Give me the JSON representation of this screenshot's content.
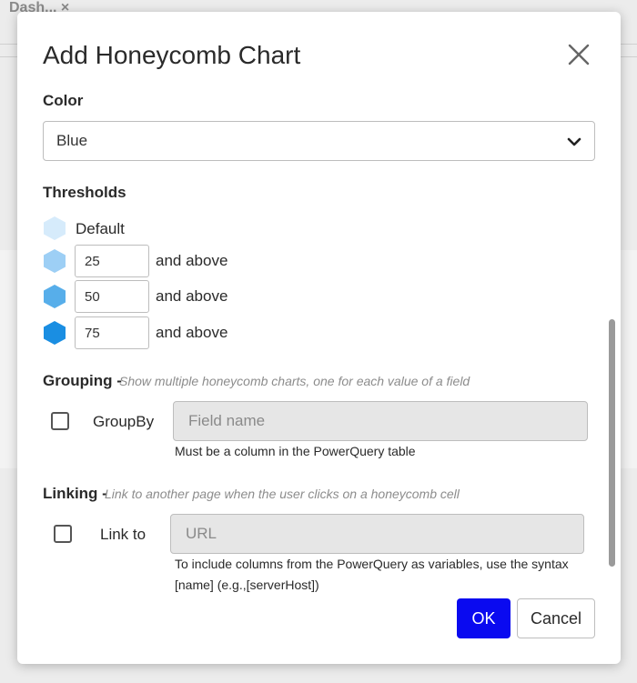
{
  "background": {
    "tab_label": "Dash... ×"
  },
  "dialog": {
    "title": "Add Honeycomb Chart",
    "close_icon": "close-icon",
    "color": {
      "label": "Color",
      "selected": "Blue"
    },
    "thresholds": {
      "label": "Thresholds",
      "default_label": "Default",
      "suffix": "and above",
      "items": [
        {
          "value": "25",
          "color": "#9dcff5"
        },
        {
          "value": "50",
          "color": "#57aeea"
        },
        {
          "value": "75",
          "color": "#1a8ee2"
        }
      ],
      "default_color": "#d6ebfb"
    },
    "grouping": {
      "label": "Grouping -",
      "hint": "Show multiple honeycomb charts, one for each value of a field",
      "checkbox_label": "GroupBy",
      "placeholder": "Field name",
      "help": "Must be a column in the PowerQuery table"
    },
    "linking": {
      "label": "Linking -",
      "hint": "Link to another page when the user clicks on a honeycomb cell",
      "checkbox_label": "Link to",
      "placeholder": "URL",
      "help_line1": "To include columns from the PowerQuery as variables, use the syntax",
      "help_line2": "[name] (e.g.,[serverHost])"
    },
    "buttons": {
      "ok": "OK",
      "cancel": "Cancel"
    },
    "colors": {
      "primary": "#0a0af0"
    }
  }
}
